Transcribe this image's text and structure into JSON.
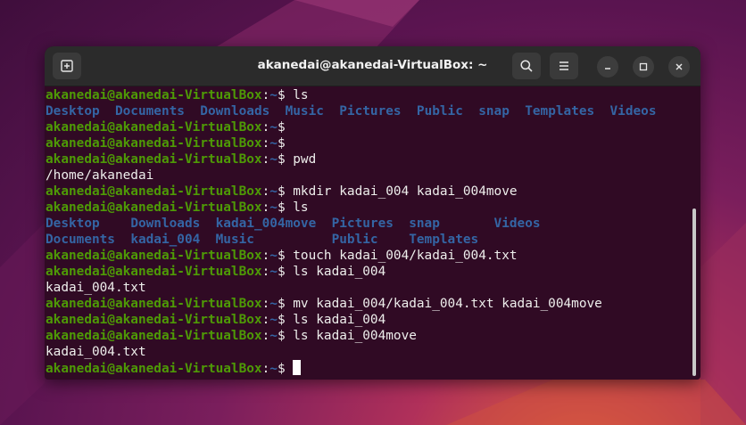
{
  "window": {
    "title": "akanedai@akanedai-VirtualBox: ~"
  },
  "prompt": {
    "user_host": "akanedai@akanedai-VirtualBox",
    "sep": ":",
    "path": "~",
    "symbol": "$"
  },
  "terminal_lines": [
    {
      "type": "cmd",
      "text": " ls"
    },
    {
      "type": "cols",
      "cells": [
        {
          "t": "Desktop",
          "c": "dir"
        },
        {
          "t": "  "
        },
        {
          "t": "Documents",
          "c": "dir"
        },
        {
          "t": "  "
        },
        {
          "t": "Downloads",
          "c": "dir"
        },
        {
          "t": "  "
        },
        {
          "t": "Music",
          "c": "dir"
        },
        {
          "t": "  "
        },
        {
          "t": "Pictures",
          "c": "dir"
        },
        {
          "t": "  "
        },
        {
          "t": "Public",
          "c": "dir"
        },
        {
          "t": "  "
        },
        {
          "t": "snap",
          "c": "dir"
        },
        {
          "t": "  "
        },
        {
          "t": "Templates",
          "c": "dir"
        },
        {
          "t": "  "
        },
        {
          "t": "Videos",
          "c": "dir"
        }
      ]
    },
    {
      "type": "cmd",
      "text": ""
    },
    {
      "type": "cmd",
      "text": ""
    },
    {
      "type": "cmd",
      "text": " pwd"
    },
    {
      "type": "out",
      "text": "/home/akanedai"
    },
    {
      "type": "cmd",
      "text": " mkdir kadai_004 kadai_004move"
    },
    {
      "type": "cmd",
      "text": " ls"
    },
    {
      "type": "cols",
      "cells": [
        {
          "t": "Desktop",
          "c": "dir"
        },
        {
          "t": "    "
        },
        {
          "t": "Downloads",
          "c": "dir"
        },
        {
          "t": "  "
        },
        {
          "t": "kadai_004move",
          "c": "dir"
        },
        {
          "t": "  "
        },
        {
          "t": "Pictures",
          "c": "dir"
        },
        {
          "t": "  "
        },
        {
          "t": "snap",
          "c": "dir"
        },
        {
          "t": "       "
        },
        {
          "t": "Videos",
          "c": "dir"
        }
      ]
    },
    {
      "type": "cols",
      "cells": [
        {
          "t": "Documents",
          "c": "dir"
        },
        {
          "t": "  "
        },
        {
          "t": "kadai_004",
          "c": "dir"
        },
        {
          "t": "  "
        },
        {
          "t": "Music",
          "c": "dir"
        },
        {
          "t": "          "
        },
        {
          "t": "Public",
          "c": "dir"
        },
        {
          "t": "    "
        },
        {
          "t": "Templates",
          "c": "dir"
        }
      ]
    },
    {
      "type": "cmd",
      "text": " touch kadai_004/kadai_004.txt"
    },
    {
      "type": "cmd",
      "text": " ls kadai_004"
    },
    {
      "type": "out",
      "text": "kadai_004.txt"
    },
    {
      "type": "cmd",
      "text": " mv kadai_004/kadai_004.txt kadai_004move"
    },
    {
      "type": "cmd",
      "text": " ls kadai_004"
    },
    {
      "type": "cmd",
      "text": " ls kadai_004move"
    },
    {
      "type": "out",
      "text": "kadai_004.txt"
    },
    {
      "type": "cmd",
      "text": " ",
      "cursor": true
    }
  ],
  "icons": {
    "new_tab": "new-tab-icon",
    "search": "search-icon",
    "menu": "hamburger-menu-icon",
    "minimize": "minimize-icon",
    "maximize": "maximize-icon",
    "close": "close-icon"
  },
  "colors": {
    "terminal_bg": "#300a24",
    "prompt_user": "#4e9a06",
    "prompt_path": "#3465a4",
    "directory": "#3465a4",
    "text": "#eeeeec",
    "titlebar": "#2b2b2b"
  }
}
